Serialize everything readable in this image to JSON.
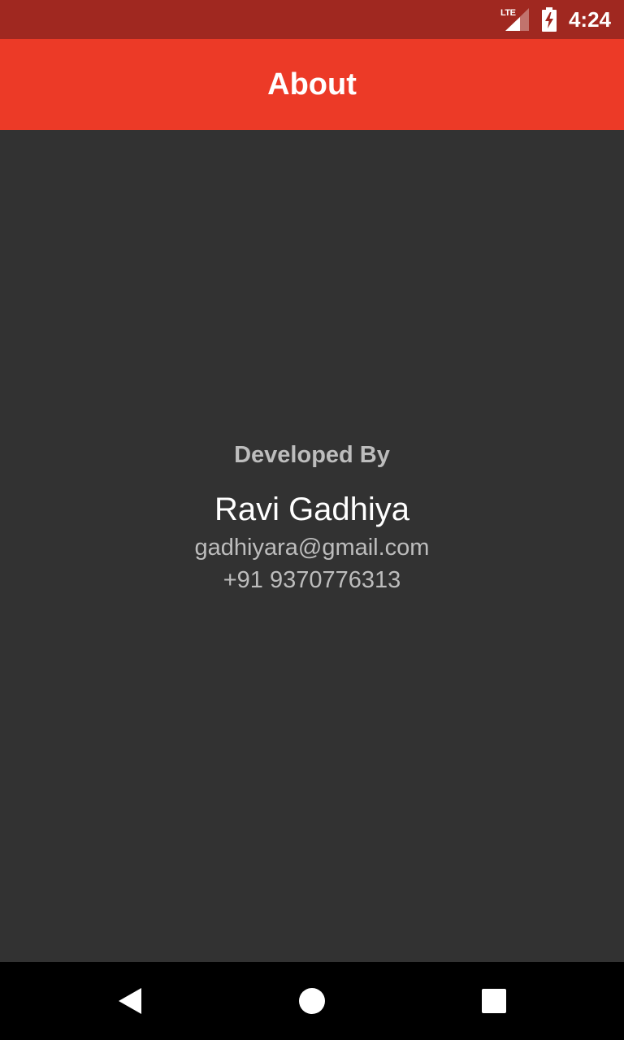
{
  "status_bar": {
    "network_label": "LTE",
    "time": "4:24",
    "icons": [
      "lte-signal-icon",
      "battery-charging-icon"
    ]
  },
  "app_bar": {
    "title": "About"
  },
  "about": {
    "heading": "Developed By",
    "name": "Ravi Gadhiya",
    "email": "gadhiyara@gmail.com",
    "phone": "+91 9370776313"
  },
  "nav_bar": {
    "icons": [
      "back-icon",
      "home-icon",
      "recents-icon"
    ]
  },
  "colors": {
    "status_bar": "#A02820",
    "app_bar": "#EC3A27",
    "background": "#323232",
    "nav_bar": "#000000",
    "secondary_text": "#BDBDBD",
    "primary_text": "#FFFFFF"
  }
}
